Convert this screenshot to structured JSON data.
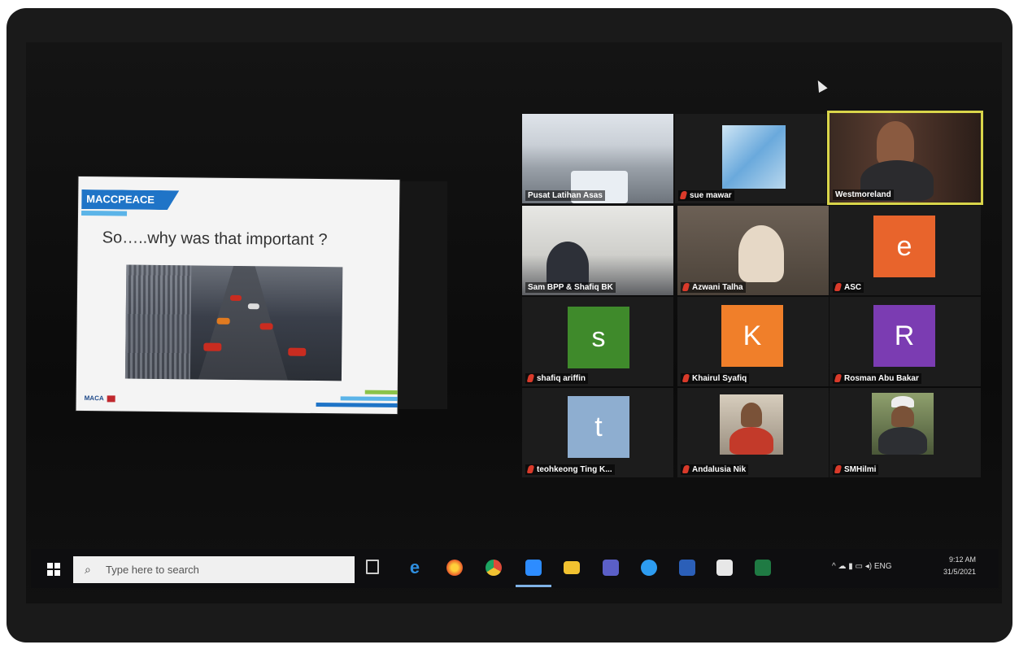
{
  "slide": {
    "brand": "MACCPEACE",
    "title": "So…..why was that important ?",
    "logo": "MACA"
  },
  "participants": [
    {
      "name": "Pusat Latihan Asas",
      "muted": false,
      "kind": "video"
    },
    {
      "name": "sue mawar",
      "muted": true,
      "kind": "picture"
    },
    {
      "name": "Westmoreland",
      "muted": false,
      "kind": "video",
      "active": true
    },
    {
      "name": "Sam BPP & Shafiq BK",
      "muted": false,
      "kind": "video"
    },
    {
      "name": "Azwani Talha",
      "muted": true,
      "kind": "video"
    },
    {
      "name": "ASC",
      "muted": true,
      "kind": "avatar",
      "initial": "e",
      "color": "#e8642c"
    },
    {
      "name": "shafiq ariffin",
      "muted": true,
      "kind": "avatar",
      "initial": "s",
      "color": "#3f8a2b"
    },
    {
      "name": "Khairul Syafiq",
      "muted": true,
      "kind": "avatar",
      "initial": "K",
      "color": "#f07f2a"
    },
    {
      "name": "Rosman Abu Bakar",
      "muted": true,
      "kind": "avatar",
      "initial": "R",
      "color": "#7b3cb2"
    },
    {
      "name": "teohkeong Ting K...",
      "muted": true,
      "kind": "avatar",
      "initial": "t",
      "color": "#8eaed0"
    },
    {
      "name": "Andalusia Nik",
      "muted": true,
      "kind": "picture"
    },
    {
      "name": "SMHilmi",
      "muted": true,
      "kind": "picture"
    }
  ],
  "taskbar": {
    "search_placeholder": "Type here to search",
    "pinned": [
      "task-view-icon",
      "edge-icon",
      "firefox-icon",
      "chrome-icon",
      "zoom-icon",
      "file-explorer-icon",
      "teams-icon",
      "safari-icon",
      "word-icon",
      "store-icon",
      "excel-icon"
    ],
    "tray_text": "ENG",
    "time": "9:12 AM",
    "date": "31/5/2021"
  },
  "colors": {
    "active_speaker": "#d9d54a",
    "mute": "#d93a2a",
    "brand_blue": "#1f74c7"
  }
}
